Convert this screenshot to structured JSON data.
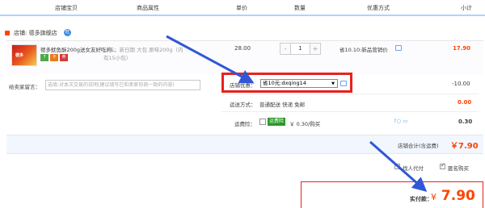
{
  "header": {
    "columns": [
      "店铺宝贝",
      "商品属性",
      "单价",
      "数量",
      "优惠方式",
      "小计"
    ]
  },
  "shop": {
    "name": "德多旗舰店"
  },
  "item": {
    "title": "德多鱿鱼酥200g送女友好吃的...",
    "tags": [
      "7",
      "卡",
      "券"
    ],
    "sku_line1": "口味：新日期 大包 原味200g（内",
    "sku_line2": "有15小包）",
    "price": "28.00",
    "quantity": "1",
    "promo": "省10.10:新品营销价",
    "subtotal": "17.90"
  },
  "message": {
    "label": "给卖家留言：",
    "placeholder": "选填:对本次交易的说明(建议填写已和卖家协商一致的内容)"
  },
  "coupon": {
    "label": "店铺优惠：",
    "selected": "省10元:dxqing14",
    "amount": "-10.00"
  },
  "shipping": {
    "label": "运送方式：",
    "options": "普通配送 快递 免邮",
    "amount": "0.00"
  },
  "insurance": {
    "label": "运费险：",
    "badge": "运费险",
    "text": "￥ 0.30/购买",
    "amount": "0.30"
  },
  "store_total": {
    "label": "店铺合计(含运费)",
    "amount": "￥7.90"
  },
  "options": {
    "proxy_pay": "找人代付",
    "anonymous": "匿名购买"
  },
  "payment": {
    "label": "实付款：",
    "symbol": "¥",
    "amount": "7.90"
  },
  "colors": {
    "accent": "#ff4400",
    "highlight": "#e8211c",
    "arrow": "#2f57d6",
    "header_border": "#b2d1ff"
  }
}
